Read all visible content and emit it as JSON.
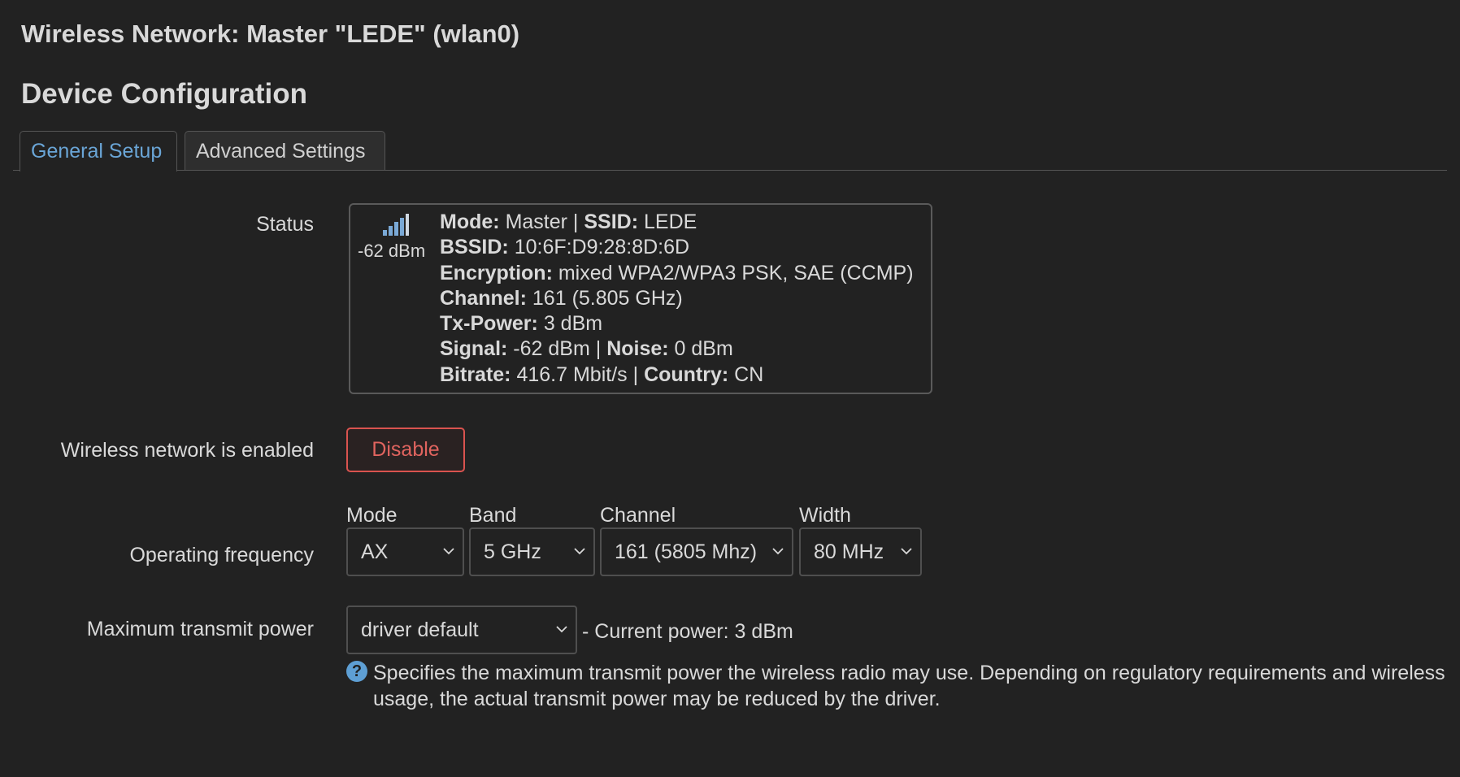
{
  "page": {
    "title": "Wireless Network: Master \"LEDE\" (wlan0)",
    "section_title": "Device Configuration"
  },
  "tabs": [
    {
      "label": "General Setup",
      "active": true
    },
    {
      "label": "Advanced Settings",
      "active": false
    }
  ],
  "status": {
    "label": "Status",
    "signal_icon": "signal-bars-icon",
    "signal_dbm": "-62 dBm",
    "mode_key": "Mode:",
    "mode_value": "Master",
    "sep": "|",
    "ssid_key": "SSID:",
    "ssid_value": "LEDE",
    "bssid_key": "BSSID:",
    "bssid_value": "10:6F:D9:28:8D:6D",
    "encryption_key": "Encryption:",
    "encryption_value": "mixed WPA2/WPA3 PSK, SAE (CCMP)",
    "channel_key": "Channel:",
    "channel_value": "161 (5.805 GHz)",
    "txpower_key": "Tx-Power:",
    "txpower_value": "3 dBm",
    "signal_key": "Signal:",
    "signal_value": "-62 dBm",
    "noise_key": "Noise:",
    "noise_value": "0 dBm",
    "bitrate_key": "Bitrate:",
    "bitrate_value": "416.7 Mbit/s",
    "country_key": "Country:",
    "country_value": "CN"
  },
  "enabled": {
    "label": "Wireless network is enabled",
    "button_label": "Disable",
    "button_color": "#d9534f"
  },
  "frequency": {
    "label": "Operating frequency",
    "mode_caption": "Mode",
    "mode_value": "AX",
    "band_caption": "Band",
    "band_value": "5 GHz",
    "channel_caption": "Channel",
    "channel_value": "161 (5805 Mhz)",
    "width_caption": "Width",
    "width_value": "80 MHz"
  },
  "txpower": {
    "label": "Maximum transmit power",
    "value": "driver default",
    "current": "- Current power: 3 dBm",
    "help_icon": "question-circle-icon",
    "help_glyph": "?",
    "help_text": "Specifies the maximum transmit power the wireless radio may use. Depending on regulatory requirements and wireless usage, the actual transmit power may be reduced by the driver."
  },
  "colors": {
    "background": "#222222",
    "accent": "#6aa5d6",
    "danger": "#d9534f"
  }
}
